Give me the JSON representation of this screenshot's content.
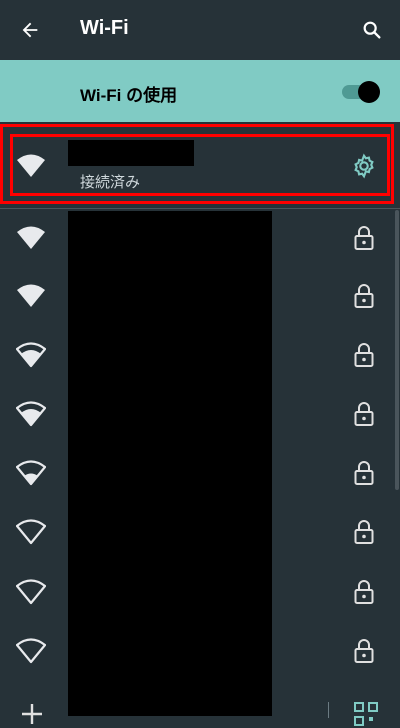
{
  "appbar": {
    "title": "Wi-Fi",
    "back_icon": "arrow-back-icon",
    "search_icon": "search-icon"
  },
  "toggle": {
    "label": "Wi-Fi の使用",
    "state": "on",
    "accent": "#80cbc4"
  },
  "connected_network": {
    "name": "",
    "status": "接続済み",
    "signal_icon": "wifi-signal-full-icon",
    "settings_icon": "gear-icon"
  },
  "networks": [
    {
      "name": "",
      "signal": "full",
      "secured": true
    },
    {
      "name": "",
      "signal": "full",
      "secured": true
    },
    {
      "name": "",
      "signal": "strong",
      "secured": true
    },
    {
      "name": "",
      "signal": "strong",
      "secured": true
    },
    {
      "name": "",
      "signal": "medium",
      "secured": true
    },
    {
      "name": "",
      "signal": "weak",
      "secured": true
    },
    {
      "name": "",
      "signal": "weak",
      "secured": true
    },
    {
      "name": "",
      "signal": "weak",
      "secured": true
    }
  ],
  "footer": {
    "add_icon": "add-icon",
    "qr_icon": "qr-code-icon"
  },
  "colors": {
    "background": "#263238",
    "toggle_bar": "#80cbc4",
    "highlight": "#ff0000",
    "gear": "#80cbc4"
  }
}
